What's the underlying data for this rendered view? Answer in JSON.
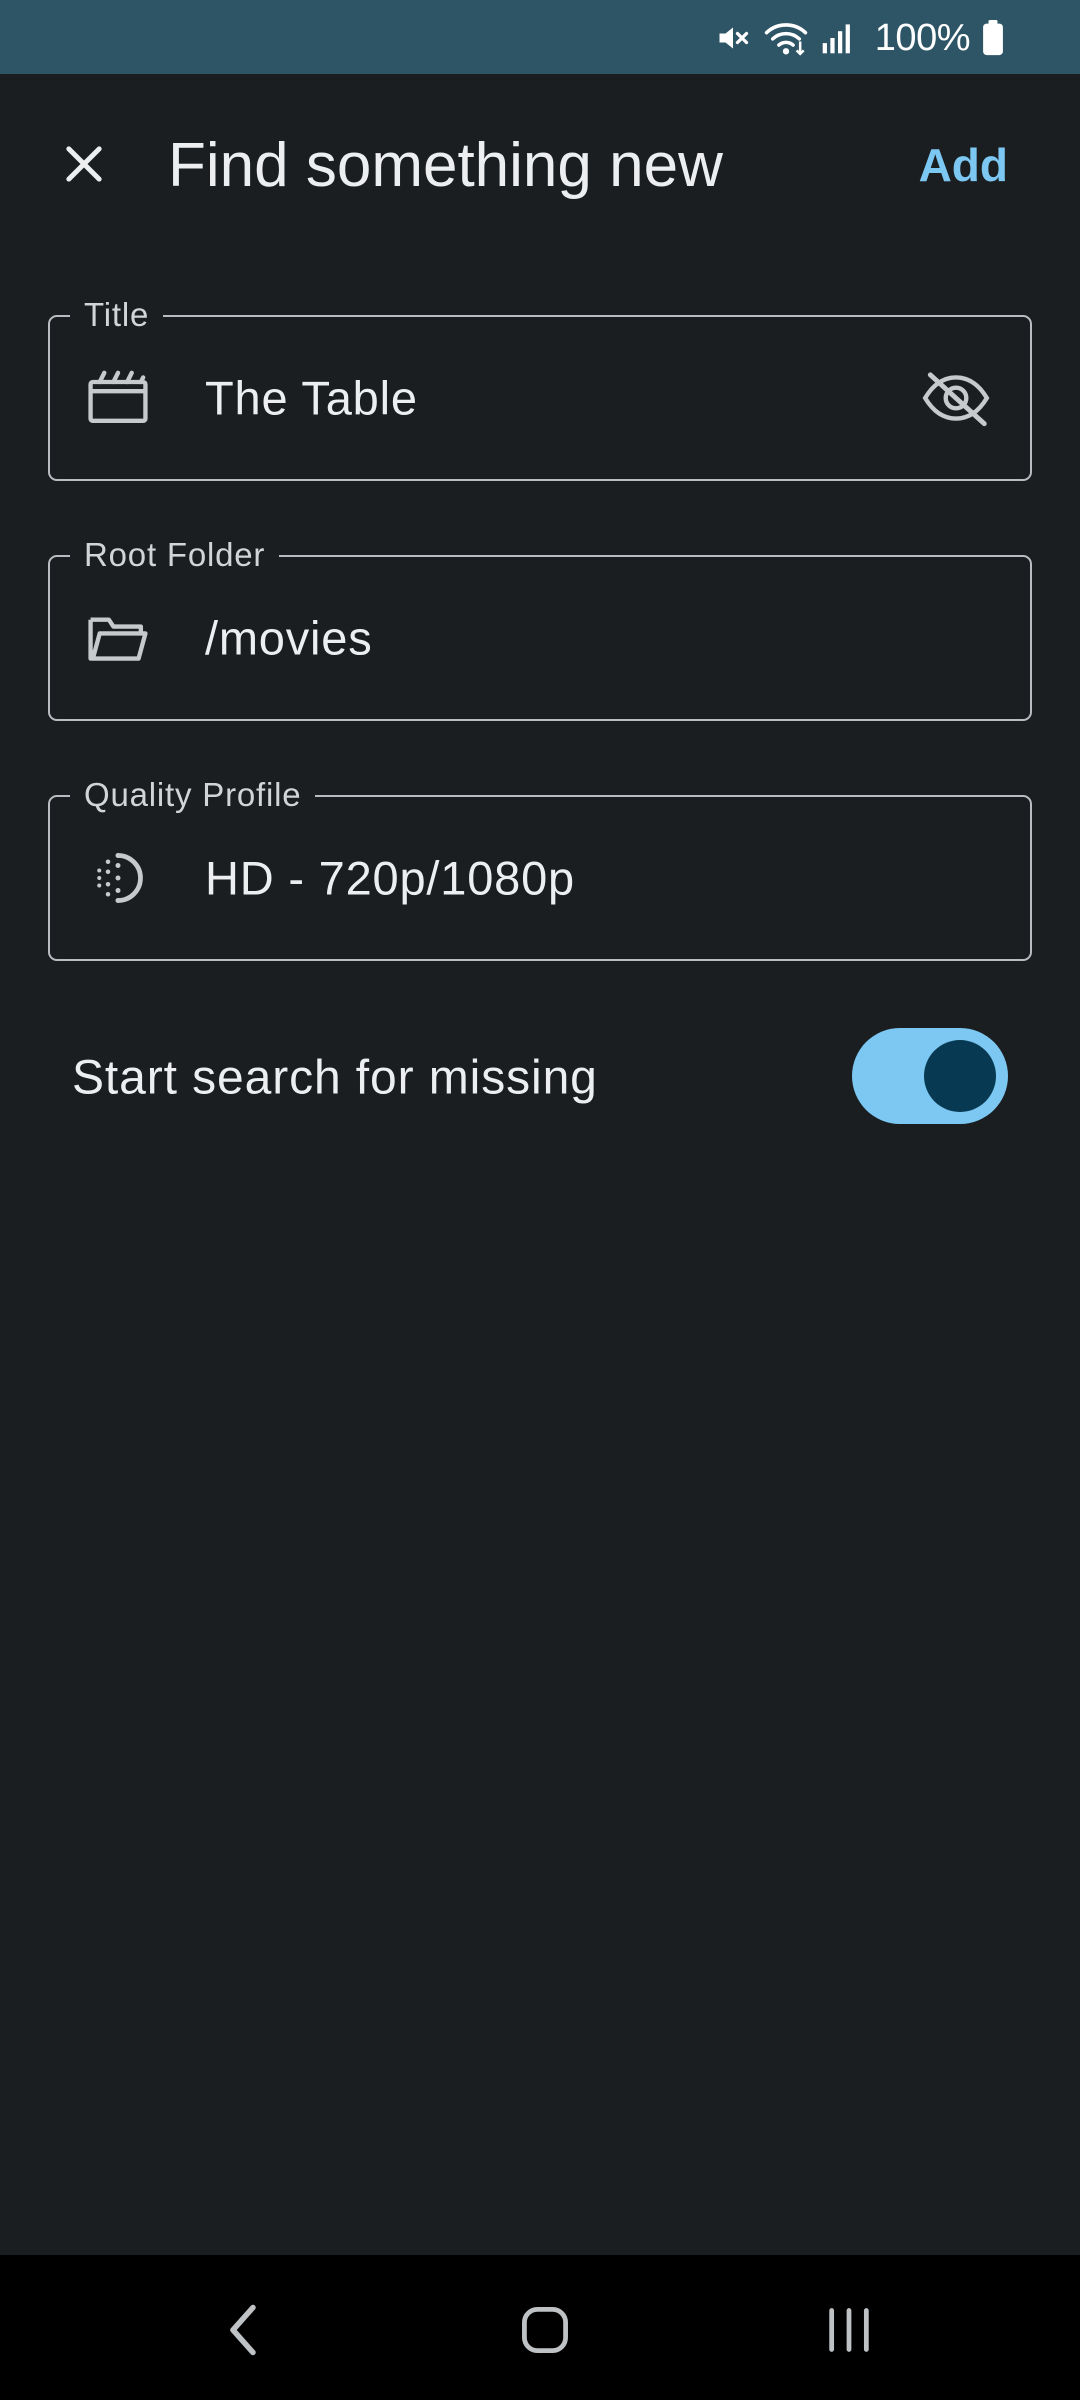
{
  "status_bar": {
    "battery_text": "100%",
    "icons": [
      "mute-icon",
      "wifi-icon",
      "signal-icon",
      "battery-icon"
    ]
  },
  "app_bar": {
    "title": "Find something new",
    "add_label": "Add",
    "close_icon": "close-icon"
  },
  "form": {
    "title_field": {
      "label": "Title",
      "value": "The Table",
      "leading_icon": "clapperboard-icon",
      "trailing_icon": "visibility-off-icon"
    },
    "root_folder_field": {
      "label": "Root Folder",
      "value": "/movies",
      "leading_icon": "folder-open-icon"
    },
    "quality_profile_field": {
      "label": "Quality Profile",
      "value": "HD - 720p/1080p",
      "leading_icon": "quality-icon"
    },
    "search_switch": {
      "label": "Start search for missing",
      "checked": true
    }
  },
  "nav_bar": {
    "buttons": [
      "back-icon",
      "home-icon",
      "recents-icon"
    ]
  },
  "colors": {
    "status_bar": "#2e5566",
    "background": "#1b1e21",
    "accent": "#7cc8f2",
    "switch_thumb": "#073a52",
    "outline": "#b9bcc0",
    "text": "#eceef0",
    "nav_bar": "#000000"
  }
}
